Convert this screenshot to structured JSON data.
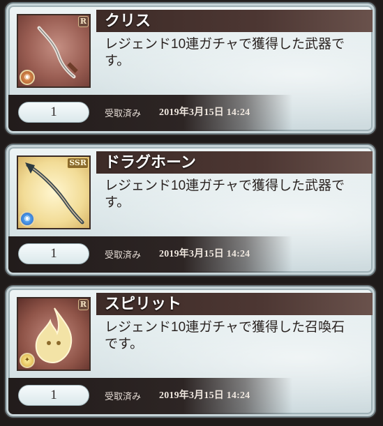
{
  "items": [
    {
      "name": "クリス",
      "rarity": "R",
      "element": "fire",
      "element_icon": "fire-element-icon",
      "description": "レジェンド10連ガチャで獲得した武器です。",
      "quantity": "1",
      "status": "受取済み",
      "date": "2019年3月15日 14:24"
    },
    {
      "name": "ドラグホーン",
      "rarity": "SSR",
      "element": "water",
      "element_icon": "water-element-icon",
      "description": "レジェンド10連ガチャで獲得した武器です。",
      "quantity": "1",
      "status": "受取済み",
      "date": "2019年3月15日 14:24"
    },
    {
      "name": "スピリット",
      "rarity": "R",
      "element": "light",
      "element_icon": "light-element-icon",
      "description": "レジェンド10連ガチャで獲得した召喚石です。",
      "quantity": "1",
      "status": "受取済み",
      "date": "2019年3月15日 14:24"
    }
  ]
}
